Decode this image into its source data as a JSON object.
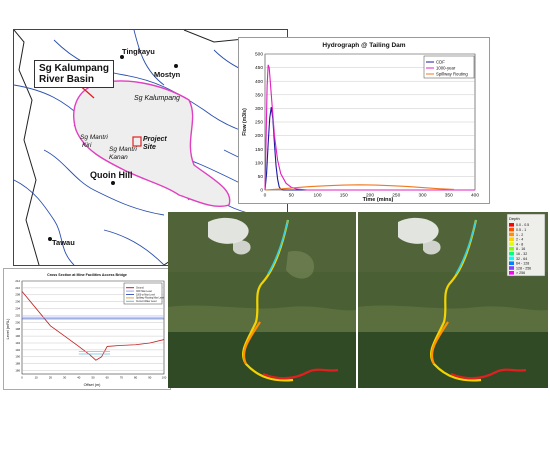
{
  "map": {
    "basin_label_line1": "Sg Kalumpang",
    "basin_label_line2": "River Basin",
    "towns": {
      "tingkayu": "Tingkayu",
      "mostyn": "Mostyn",
      "quoin_hill": "Quoin Hill",
      "tawau": "Tawau"
    },
    "rivers": {
      "kalumpang": "Sg Kalumpang",
      "mantri_kiri_1": "Sg Mantri",
      "mantri_kiri_2": "Kiri",
      "mantri_kanan_1": "Sg Mantri",
      "mantri_kanan_2": "Kanan"
    },
    "project_site_line1": "Project",
    "project_site_line2": "Site",
    "colors": {
      "basin": "#e040c0",
      "river": "#2a4fb0",
      "arrow": "#e02020"
    }
  },
  "hydrograph": {
    "chart_data": {
      "type": "line",
      "title": "Hydrograph @ Tailing Dam",
      "xlabel": "Time (mins)",
      "ylabel": "Flow (m3/s)",
      "xlim": [
        0,
        400
      ],
      "ylim": [
        0,
        500
      ],
      "xticks": [
        "0",
        "50",
        "100",
        "150",
        "200",
        "250",
        "300",
        "350",
        "400"
      ],
      "yticks": [
        "0",
        "50",
        "100",
        "150",
        "200",
        "250",
        "300",
        "350",
        "400",
        "450",
        "500"
      ],
      "legend_position": "top-right",
      "series": [
        {
          "name": "CDF",
          "color": "#1a1aa0",
          "x": [
            0,
            3,
            6,
            9,
            12,
            15,
            18,
            21,
            24,
            27,
            30,
            35,
            400
          ],
          "y": [
            0,
            60,
            170,
            265,
            305,
            260,
            170,
            90,
            40,
            12,
            3,
            0,
            0
          ]
        },
        {
          "name": "1000-year",
          "color": "#e020c0",
          "x": [
            0,
            2,
            4,
            6,
            8,
            10,
            14,
            18,
            24,
            30,
            40,
            50,
            60,
            80,
            400
          ],
          "y": [
            0,
            180,
            380,
            460,
            450,
            400,
            300,
            200,
            110,
            60,
            25,
            10,
            4,
            0,
            0
          ]
        },
        {
          "name": "Spillway Routing",
          "color": "#f07820",
          "x": [
            0,
            30,
            60,
            90,
            120,
            150,
            180,
            210,
            240,
            270,
            300,
            330,
            360
          ],
          "y": [
            0,
            4,
            9,
            13,
            16,
            18,
            19,
            18,
            16,
            13,
            9,
            5,
            2
          ]
        }
      ]
    }
  },
  "cross_section": {
    "chart_data": {
      "type": "line",
      "title": "Cross Section at Mine Facilities Access Bridge",
      "xlabel": "Offset (m)",
      "ylabel": "Level (mRL)",
      "xlim": [
        0,
        100
      ],
      "ylim": [
        185,
        212
      ],
      "xticks": [
        "0",
        "10",
        "20",
        "30",
        "40",
        "50",
        "60",
        "70",
        "80",
        "90",
        "100"
      ],
      "yticks": [
        "186",
        "188",
        "190",
        "192",
        "194",
        "196",
        "198",
        "200",
        "202",
        "204",
        "206",
        "208",
        "210",
        "212"
      ],
      "legend_position": "top-right",
      "series": [
        {
          "name": "Ground",
          "color": "#c02020",
          "x": [
            0,
            10,
            20,
            30,
            40,
            48,
            52,
            56,
            60,
            70,
            80,
            90,
            100
          ],
          "y": [
            209,
            204,
            199,
            196,
            193,
            190.5,
            189,
            190,
            193,
            193.3,
            193.5,
            194,
            195
          ]
        },
        {
          "name": "CDF Max Level",
          "color": "#a0a0ff",
          "x": [
            0,
            100
          ],
          "y": [
            201.5,
            201.5
          ]
        },
        {
          "name": "1000-yr Max Level",
          "color": "#4060c0",
          "x": [
            0,
            100
          ],
          "y": [
            201,
            201
          ]
        },
        {
          "name": "Spillway Routing Max Level",
          "color": "#f0a040",
          "x": [
            40,
            62
          ],
          "y": [
            191.5,
            191.5
          ]
        },
        {
          "name": "Current Water Level",
          "color": "#60c0e0",
          "x": [
            40,
            62
          ],
          "y": [
            190.8,
            190.8
          ]
        }
      ]
    }
  },
  "flood_legend": {
    "title": "Depth",
    "items": [
      {
        "label": "0.0 - 0.5",
        "color": "#ff0000"
      },
      {
        "label": "0.5 - 1",
        "color": "#ff5000"
      },
      {
        "label": "1 - 2",
        "color": "#ff9000"
      },
      {
        "label": "2 - 4",
        "color": "#ffd000"
      },
      {
        "label": "4 - 8",
        "color": "#e0ff00"
      },
      {
        "label": "8 - 16",
        "color": "#80ff00"
      },
      {
        "label": "16 - 32",
        "color": "#00ff80"
      },
      {
        "label": "32 - 64",
        "color": "#00ffff"
      },
      {
        "label": "64 - 128",
        "color": "#0080ff"
      },
      {
        "label": "128 - 256",
        "color": "#8040ff"
      },
      {
        "label": "> 256",
        "color": "#ff00ff"
      }
    ]
  }
}
